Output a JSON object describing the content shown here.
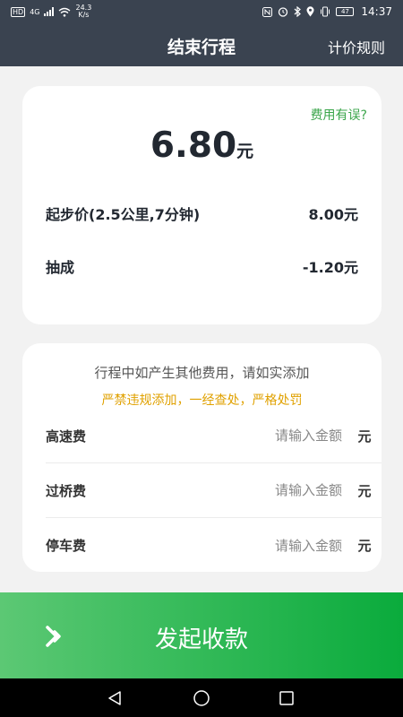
{
  "status_bar": {
    "hd": "HD",
    "network": "4G",
    "speed_value": "24.3",
    "speed_unit": "K/s",
    "battery": "47",
    "time": "14:37"
  },
  "header": {
    "title": "结束行程",
    "pricing_rules": "计价规则"
  },
  "fare_card": {
    "fee_error": "费用有误?",
    "total_amount": "6.80",
    "currency_unit": "元",
    "rows": [
      {
        "label": "起步价(2.5公里,7分钟)",
        "value": "8.00元"
      },
      {
        "label": "抽成",
        "value": "-1.20元"
      }
    ]
  },
  "extra_fees": {
    "notice": "行程中如产生其他费用，请如实添加",
    "warning": "严禁违规添加，一经查处，严格处罚",
    "placeholder": "请输入金额",
    "unit": "元",
    "items": [
      {
        "label": "高速费",
        "value": ""
      },
      {
        "label": "过桥费",
        "value": ""
      },
      {
        "label": "停车费",
        "value": ""
      }
    ]
  },
  "action": {
    "charge_label": "发起收款"
  },
  "colors": {
    "header_bg": "#3a4350",
    "accent_green": "#0aab3c",
    "link_green": "#3aa54a",
    "warning_orange": "#e0a100"
  }
}
